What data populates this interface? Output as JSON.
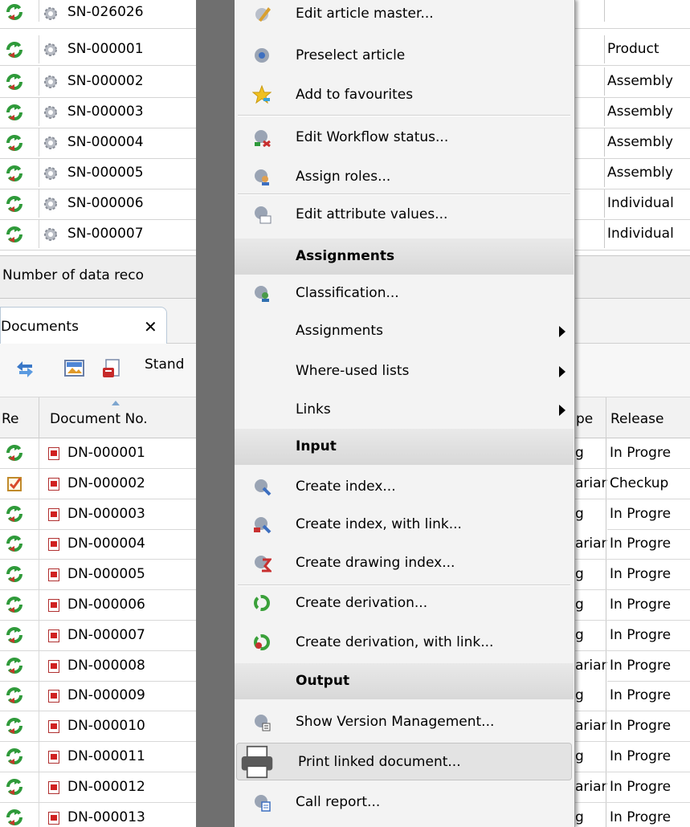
{
  "articles": [
    {
      "number": "SN-026026",
      "type": ""
    },
    {
      "number": "SN-000001",
      "type": "Product"
    },
    {
      "number": "SN-000002",
      "type": "Assembly"
    },
    {
      "number": "SN-000003",
      "type": "Assembly"
    },
    {
      "number": "SN-000004",
      "type": "Assembly"
    },
    {
      "number": "SN-000005",
      "type": "Assembly"
    },
    {
      "number": "SN-000006",
      "type": "Individual"
    },
    {
      "number": "SN-000007",
      "type": "Individual"
    }
  ],
  "record_count_label": "Number of data reco",
  "documents_tab": {
    "label": "Documents",
    "close": "✕"
  },
  "toolbar": {
    "view_select": "Stand"
  },
  "doc_headers": {
    "status": "Re",
    "number": "Document No.",
    "type": "pe",
    "release": "Release"
  },
  "documents": [
    {
      "number": "DN-000001",
      "type": "g",
      "release": "In Progre",
      "status": "refresh"
    },
    {
      "number": "DN-000002",
      "type": "ariar",
      "release": "Checkup",
      "status": "checkup"
    },
    {
      "number": "DN-000003",
      "type": "g",
      "release": "In Progre",
      "status": "refresh"
    },
    {
      "number": "DN-000004",
      "type": "ariar",
      "release": "In Progre",
      "status": "refresh"
    },
    {
      "number": "DN-000005",
      "type": "g",
      "release": "In Progre",
      "status": "refresh"
    },
    {
      "number": "DN-000006",
      "type": "g",
      "release": "In Progre",
      "status": "refresh"
    },
    {
      "number": "DN-000007",
      "type": "g",
      "release": "In Progre",
      "status": "refresh"
    },
    {
      "number": "DN-000008",
      "type": "ariar",
      "release": "In Progre",
      "status": "refresh"
    },
    {
      "number": "DN-000009",
      "type": "g",
      "release": "In Progre",
      "status": "refresh"
    },
    {
      "number": "DN-000010",
      "type": "ariar",
      "release": "In Progre",
      "status": "refresh"
    },
    {
      "number": "DN-000011",
      "type": "g",
      "release": "In Progre",
      "status": "refresh"
    },
    {
      "number": "DN-000012",
      "type": "ariar",
      "release": "In Progre",
      "status": "refresh"
    },
    {
      "number": "DN-000013",
      "type": "g",
      "release": "In Progre",
      "status": "refresh"
    }
  ],
  "context_menu": {
    "items": [
      {
        "kind": "item",
        "label": "Edit article master...",
        "icon": "edit-article-icon"
      },
      {
        "kind": "item",
        "label": "Preselect article",
        "icon": "preselect-icon"
      },
      {
        "kind": "item",
        "label": "Add to favourites",
        "icon": "star-icon"
      },
      {
        "kind": "item",
        "label": "Edit Workflow status...",
        "icon": "workflow-icon"
      },
      {
        "kind": "item",
        "label": "Assign roles...",
        "icon": "roles-icon"
      },
      {
        "kind": "item",
        "label": "Edit attribute values...",
        "icon": "attributes-icon"
      },
      {
        "kind": "section",
        "label": "Assignments"
      },
      {
        "kind": "item",
        "label": "Classification...",
        "icon": "classification-icon"
      },
      {
        "kind": "item",
        "label": "Assignments",
        "submenu": true
      },
      {
        "kind": "item",
        "label": "Where-used lists",
        "submenu": true
      },
      {
        "kind": "item",
        "label": "Links",
        "submenu": true
      },
      {
        "kind": "section",
        "label": "Input"
      },
      {
        "kind": "item",
        "label": "Create index...",
        "icon": "create-index-icon"
      },
      {
        "kind": "item",
        "label": "Create index, with link...",
        "icon": "create-index-link-icon"
      },
      {
        "kind": "item",
        "label": "Create drawing index...",
        "icon": "drawing-index-icon"
      },
      {
        "kind": "item",
        "label": "Create derivation...",
        "icon": "derivation-icon"
      },
      {
        "kind": "item",
        "label": "Create derivation, with link...",
        "icon": "derivation-link-icon"
      },
      {
        "kind": "section",
        "label": "Output"
      },
      {
        "kind": "item",
        "label": "Show Version Management...",
        "icon": "version-icon"
      },
      {
        "kind": "item",
        "label": "Print linked document...",
        "icon": "printer-icon",
        "highlighted": true
      },
      {
        "kind": "item",
        "label": "Call report...",
        "icon": "report-icon"
      }
    ]
  }
}
